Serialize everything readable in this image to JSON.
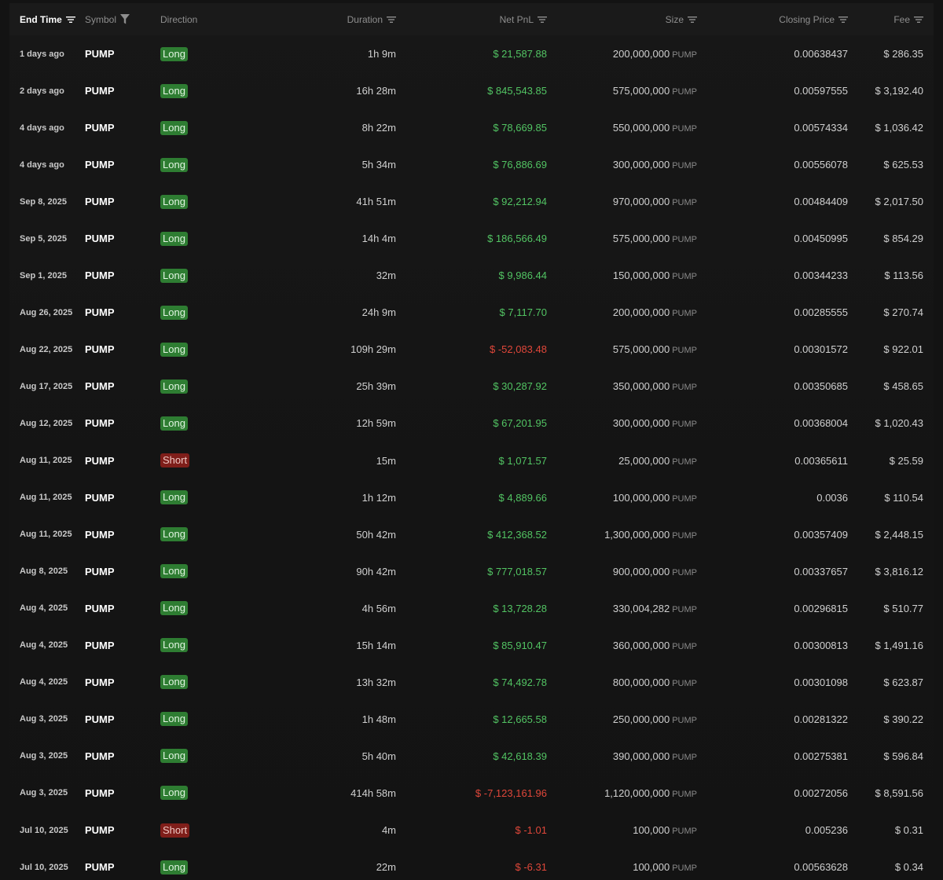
{
  "colors": {
    "background": "#131313",
    "positive": "#52c463",
    "negative": "#e0473a",
    "long_badge": "#2e7d32",
    "short_badge": "#7f1e1a"
  },
  "headers": {
    "end_time": "End Time",
    "symbol": "Symbol",
    "direction": "Direction",
    "duration": "Duration",
    "net_pnl": "Net PnL",
    "size": "Size",
    "closing_price": "Closing Price",
    "fee": "Fee"
  },
  "header_icons": {
    "sort": "sort-lines-icon",
    "filter": "funnel-icon"
  },
  "rows": [
    {
      "end_time": "1 days ago",
      "symbol": "PUMP",
      "direction": "Long",
      "duration": "1h 9m",
      "pnl": "$ 21,587.88",
      "pnl_sign": "pos",
      "size": "200,000,000",
      "size_unit": "PUMP",
      "closing_price": "0.00638437",
      "fee": "$ 286.35"
    },
    {
      "end_time": "2 days ago",
      "symbol": "PUMP",
      "direction": "Long",
      "duration": "16h 28m",
      "pnl": "$ 845,543.85",
      "pnl_sign": "pos",
      "size": "575,000,000",
      "size_unit": "PUMP",
      "closing_price": "0.00597555",
      "fee": "$ 3,192.40"
    },
    {
      "end_time": "4 days ago",
      "symbol": "PUMP",
      "direction": "Long",
      "duration": "8h 22m",
      "pnl": "$ 78,669.85",
      "pnl_sign": "pos",
      "size": "550,000,000",
      "size_unit": "PUMP",
      "closing_price": "0.00574334",
      "fee": "$ 1,036.42"
    },
    {
      "end_time": "4 days ago",
      "symbol": "PUMP",
      "direction": "Long",
      "duration": "5h 34m",
      "pnl": "$ 76,886.69",
      "pnl_sign": "pos",
      "size": "300,000,000",
      "size_unit": "PUMP",
      "closing_price": "0.00556078",
      "fee": "$ 625.53"
    },
    {
      "end_time": "Sep 8, 2025",
      "symbol": "PUMP",
      "direction": "Long",
      "duration": "41h 51m",
      "pnl": "$ 92,212.94",
      "pnl_sign": "pos",
      "size": "970,000,000",
      "size_unit": "PUMP",
      "closing_price": "0.00484409",
      "fee": "$ 2,017.50"
    },
    {
      "end_time": "Sep 5, 2025",
      "symbol": "PUMP",
      "direction": "Long",
      "duration": "14h 4m",
      "pnl": "$ 186,566.49",
      "pnl_sign": "pos",
      "size": "575,000,000",
      "size_unit": "PUMP",
      "closing_price": "0.00450995",
      "fee": "$ 854.29"
    },
    {
      "end_time": "Sep 1, 2025",
      "symbol": "PUMP",
      "direction": "Long",
      "duration": "32m",
      "pnl": "$ 9,986.44",
      "pnl_sign": "pos",
      "size": "150,000,000",
      "size_unit": "PUMP",
      "closing_price": "0.00344233",
      "fee": "$ 113.56"
    },
    {
      "end_time": "Aug 26, 2025",
      "symbol": "PUMP",
      "direction": "Long",
      "duration": "24h 9m",
      "pnl": "$ 7,117.70",
      "pnl_sign": "pos",
      "size": "200,000,000",
      "size_unit": "PUMP",
      "closing_price": "0.00285555",
      "fee": "$ 270.74"
    },
    {
      "end_time": "Aug 22, 2025",
      "symbol": "PUMP",
      "direction": "Long",
      "duration": "109h 29m",
      "pnl": "$ -52,083.48",
      "pnl_sign": "neg",
      "size": "575,000,000",
      "size_unit": "PUMP",
      "closing_price": "0.00301572",
      "fee": "$ 922.01"
    },
    {
      "end_time": "Aug 17, 2025",
      "symbol": "PUMP",
      "direction": "Long",
      "duration": "25h 39m",
      "pnl": "$ 30,287.92",
      "pnl_sign": "pos",
      "size": "350,000,000",
      "size_unit": "PUMP",
      "closing_price": "0.00350685",
      "fee": "$ 458.65"
    },
    {
      "end_time": "Aug 12, 2025",
      "symbol": "PUMP",
      "direction": "Long",
      "duration": "12h 59m",
      "pnl": "$ 67,201.95",
      "pnl_sign": "pos",
      "size": "300,000,000",
      "size_unit": "PUMP",
      "closing_price": "0.00368004",
      "fee": "$ 1,020.43"
    },
    {
      "end_time": "Aug 11, 2025",
      "symbol": "PUMP",
      "direction": "Short",
      "duration": "15m",
      "pnl": "$ 1,071.57",
      "pnl_sign": "pos",
      "size": "25,000,000",
      "size_unit": "PUMP",
      "closing_price": "0.00365611",
      "fee": "$ 25.59"
    },
    {
      "end_time": "Aug 11, 2025",
      "symbol": "PUMP",
      "direction": "Long",
      "duration": "1h 12m",
      "pnl": "$ 4,889.66",
      "pnl_sign": "pos",
      "size": "100,000,000",
      "size_unit": "PUMP",
      "closing_price": "0.0036",
      "fee": "$ 110.54"
    },
    {
      "end_time": "Aug 11, 2025",
      "symbol": "PUMP",
      "direction": "Long",
      "duration": "50h 42m",
      "pnl": "$ 412,368.52",
      "pnl_sign": "pos",
      "size": "1,300,000,000",
      "size_unit": "PUMP",
      "closing_price": "0.00357409",
      "fee": "$ 2,448.15"
    },
    {
      "end_time": "Aug 8, 2025",
      "symbol": "PUMP",
      "direction": "Long",
      "duration": "90h 42m",
      "pnl": "$ 777,018.57",
      "pnl_sign": "pos",
      "size": "900,000,000",
      "size_unit": "PUMP",
      "closing_price": "0.00337657",
      "fee": "$ 3,816.12"
    },
    {
      "end_time": "Aug 4, 2025",
      "symbol": "PUMP",
      "direction": "Long",
      "duration": "4h 56m",
      "pnl": "$ 13,728.28",
      "pnl_sign": "pos",
      "size": "330,004,282",
      "size_unit": "PUMP",
      "closing_price": "0.00296815",
      "fee": "$ 510.77"
    },
    {
      "end_time": "Aug 4, 2025",
      "symbol": "PUMP",
      "direction": "Long",
      "duration": "15h 14m",
      "pnl": "$ 85,910.47",
      "pnl_sign": "pos",
      "size": "360,000,000",
      "size_unit": "PUMP",
      "closing_price": "0.00300813",
      "fee": "$ 1,491.16"
    },
    {
      "end_time": "Aug 4, 2025",
      "symbol": "PUMP",
      "direction": "Long",
      "duration": "13h 32m",
      "pnl": "$ 74,492.78",
      "pnl_sign": "pos",
      "size": "800,000,000",
      "size_unit": "PUMP",
      "closing_price": "0.00301098",
      "fee": "$ 623.87"
    },
    {
      "end_time": "Aug 3, 2025",
      "symbol": "PUMP",
      "direction": "Long",
      "duration": "1h 48m",
      "pnl": "$ 12,665.58",
      "pnl_sign": "pos",
      "size": "250,000,000",
      "size_unit": "PUMP",
      "closing_price": "0.00281322",
      "fee": "$ 390.22"
    },
    {
      "end_time": "Aug 3, 2025",
      "symbol": "PUMP",
      "direction": "Long",
      "duration": "5h 40m",
      "pnl": "$ 42,618.39",
      "pnl_sign": "pos",
      "size": "390,000,000",
      "size_unit": "PUMP",
      "closing_price": "0.00275381",
      "fee": "$ 596.84"
    },
    {
      "end_time": "Aug 3, 2025",
      "symbol": "PUMP",
      "direction": "Long",
      "duration": "414h 58m",
      "pnl": "$ -7,123,161.96",
      "pnl_sign": "neg",
      "size": "1,120,000,000",
      "size_unit": "PUMP",
      "closing_price": "0.00272056",
      "fee": "$ 8,591.56"
    },
    {
      "end_time": "Jul 10, 2025",
      "symbol": "PUMP",
      "direction": "Short",
      "duration": "4m",
      "pnl": "$ -1.01",
      "pnl_sign": "neg",
      "size": "100,000",
      "size_unit": "PUMP",
      "closing_price": "0.005236",
      "fee": "$ 0.31"
    },
    {
      "end_time": "Jul 10, 2025",
      "symbol": "PUMP",
      "direction": "Long",
      "duration": "22m",
      "pnl": "$ -6.31",
      "pnl_sign": "neg",
      "size": "100,000",
      "size_unit": "PUMP",
      "closing_price": "0.00563628",
      "fee": "$ 0.34"
    }
  ]
}
